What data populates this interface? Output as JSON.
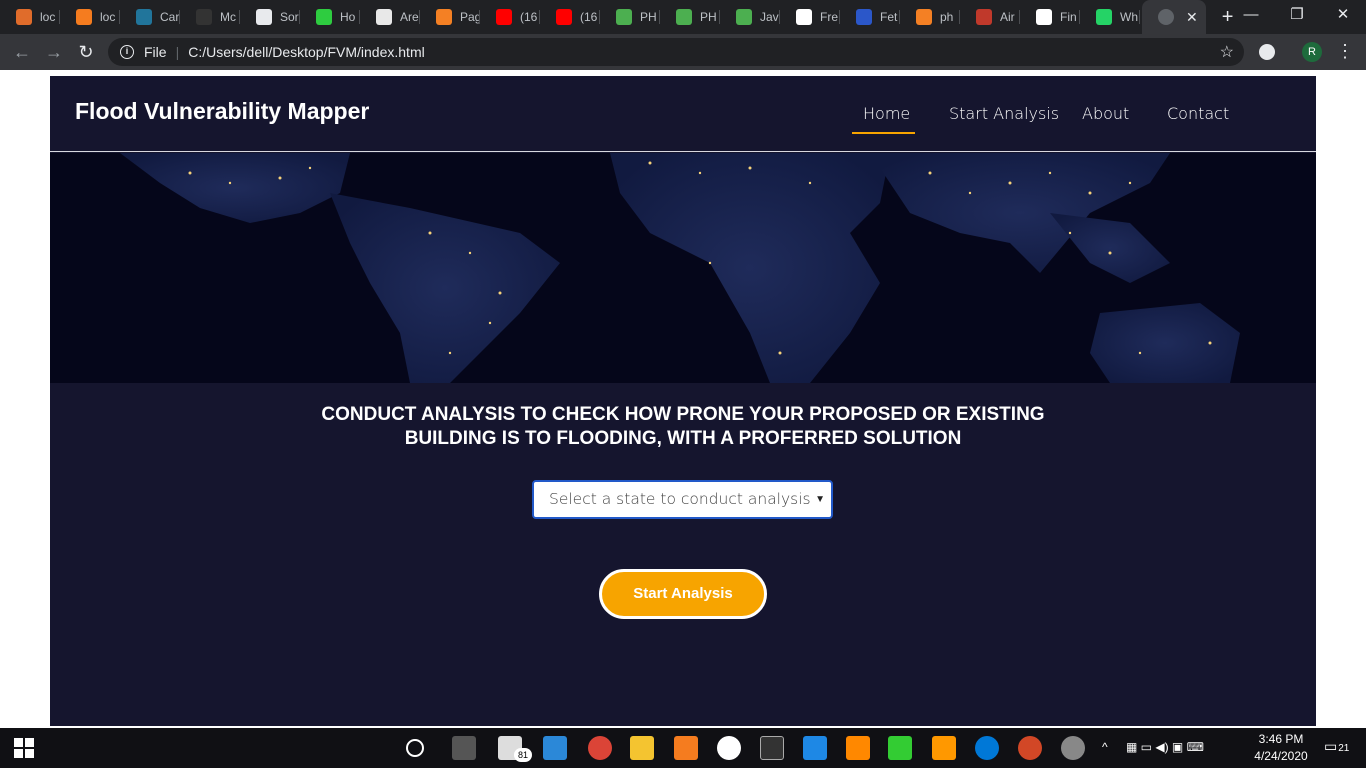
{
  "browser": {
    "tabs": [
      {
        "label": "loc",
        "color": "#e06c2b"
      },
      {
        "label": "loc",
        "color": "#f57c1f"
      },
      {
        "label": "Car",
        "color": "#21759b"
      },
      {
        "label": "Mc",
        "color": "#333333"
      },
      {
        "label": "Sor",
        "color": "#e8eaed"
      },
      {
        "label": "Ho",
        "color": "#2ecc40"
      },
      {
        "label": "Are",
        "color": "#e8e8e8"
      },
      {
        "label": "Pag",
        "color": "#f48024"
      },
      {
        "label": "(16",
        "color": "#ff0000"
      },
      {
        "label": "(16",
        "color": "#ff0000"
      },
      {
        "label": "PH",
        "color": "#4caf50"
      },
      {
        "label": "PH",
        "color": "#4caf50"
      },
      {
        "label": "Jav",
        "color": "#4caf50"
      },
      {
        "label": "Fre",
        "color": "#ffffff"
      },
      {
        "label": "Fet",
        "color": "#2b57c9"
      },
      {
        "label": "ph",
        "color": "#f48024"
      },
      {
        "label": "Air",
        "color": "#c0392b"
      },
      {
        "label": "Fin",
        "color": "#ffffff"
      },
      {
        "label": "Wh",
        "color": "#25d366"
      }
    ],
    "active_tab_close": "✕",
    "new_tab": "+",
    "window_controls": {
      "minimize": "—",
      "restore": "❐",
      "close": "✕"
    },
    "omnibox": {
      "scheme_label": "File",
      "url": "C:/Users/dell/Desktop/FVM/index.html"
    },
    "profile_initial": "R",
    "icons": {
      "back": "back-arrow-icon",
      "forward": "forward-arrow-icon",
      "reload": "reload-icon",
      "info": "info-icon",
      "bookmark": "star-icon",
      "menu": "more-vert-icon"
    }
  },
  "site": {
    "brand": "Flood Vulnerability Mapper",
    "nav": [
      {
        "label": "Home",
        "active": true
      },
      {
        "label": "Start Analysis",
        "active": false
      },
      {
        "label": "About",
        "active": false
      },
      {
        "label": "Contact",
        "active": false
      }
    ],
    "heading_line1": "CONDUCT ANALYSIS TO CHECK HOW PRONE YOUR PROPOSED OR EXISTING",
    "heading_line2": "BUILDING IS TO FLOODING, WITH A PROFERRED SOLUTION",
    "state_select": {
      "selected": "Select a state to conduct analysis"
    },
    "start_button": "Start Analysis",
    "colors": {
      "background": "#15152e",
      "accent": "#f7a400",
      "select_border": "#2259c9"
    }
  },
  "taskbar": {
    "time": "3:46 PM",
    "date": "4/24/2020",
    "mail_badge": "81",
    "notification_count": "21"
  }
}
